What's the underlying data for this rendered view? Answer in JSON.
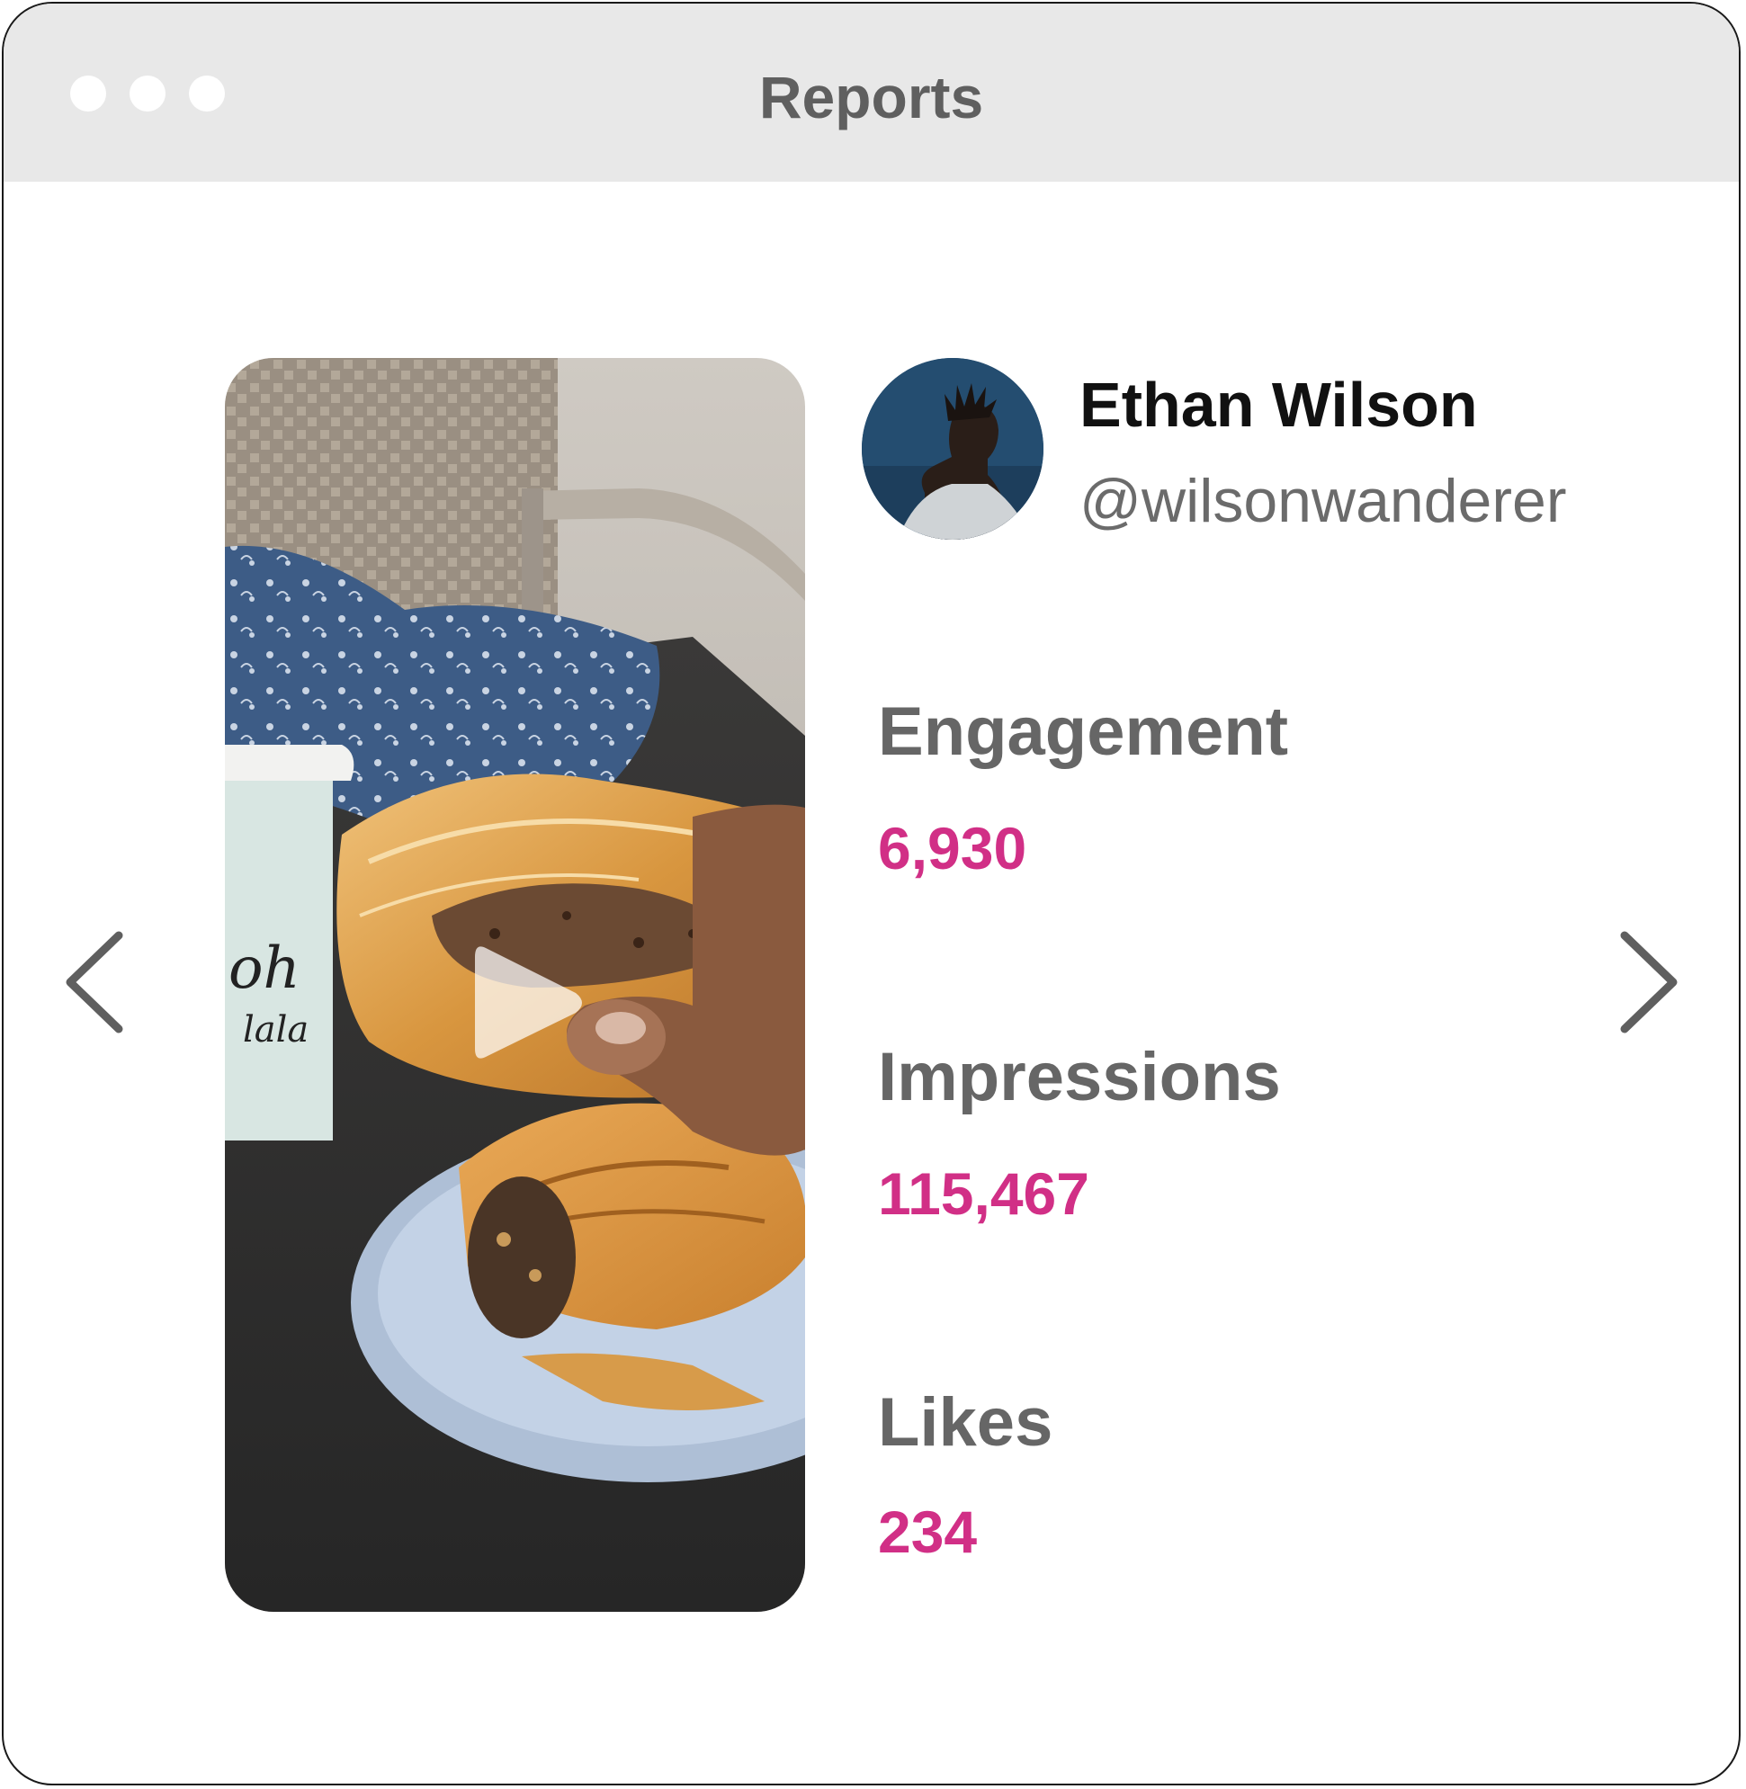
{
  "window": {
    "title": "Reports"
  },
  "profile": {
    "name": "Ethan Wilson",
    "handle": "@wilsonwanderer"
  },
  "media": {
    "type": "video",
    "play_icon": "play-icon"
  },
  "metrics": [
    {
      "label": "Engagement",
      "value": "6,930"
    },
    {
      "label": "Impressions",
      "value": "115,467"
    },
    {
      "label": "Likes",
      "value": "234"
    }
  ],
  "colors": {
    "accent": "#d12f86",
    "titlebar": "#e8e8e8",
    "label": "#666666"
  },
  "icons": {
    "prev": "chevron-left-icon",
    "next": "chevron-right-icon"
  }
}
